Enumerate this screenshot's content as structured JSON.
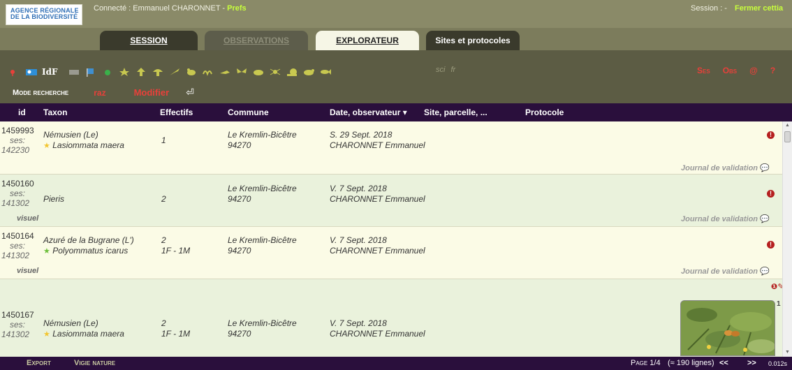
{
  "header": {
    "logo_line1": "AGENCE RÉGIONALE",
    "logo_line2": "DE LA BIODIVERSITÉ",
    "connected_label": "Connecté : Emmanuel CHARONNET - ",
    "prefs_label": "Prefs",
    "session_label": "Session : -",
    "close_label": "Fermer cettia"
  },
  "tabs": [
    {
      "label": "SESSION"
    },
    {
      "label": "OBSERVATIONS"
    },
    {
      "label": "EXPLORATEUR"
    },
    {
      "label": "Sites et protocoles"
    }
  ],
  "toolbar": {
    "idf_label": "IdF",
    "sci_label": "sci",
    "fr_label": "fr",
    "ses_label": "Ses",
    "obs_label": "Obs",
    "at_label": "@",
    "help_label": "?",
    "mode_label": "Mode recherche",
    "raz_label": "raz",
    "modifier_label": "Modifier",
    "taxon_group_icons": [
      "bird-icon",
      "tree-icon",
      "mushroom-icon",
      "dragonfly-icon",
      "frog-icon",
      "worm-icon",
      "grasshopper-icon",
      "butterfly-icon",
      "beetle-icon",
      "spider-icon",
      "snail-icon",
      "mammal-icon",
      "fish-icon"
    ]
  },
  "table": {
    "columns": [
      "id",
      "Taxon",
      "Effectifs",
      "Commune",
      "Date, observateur ▾",
      "Site, parcelle, ...",
      "Protocole"
    ],
    "rows": [
      {
        "id": "1459993",
        "ses_label": "ses:",
        "ses_id": "142230",
        "taxon_fr": "Némusien (Le)",
        "taxon_sci": "Lasiommata maera",
        "star_color": "#f2c530",
        "effectifs": "1",
        "effectifs_detail": "",
        "commune": "Le Kremlin-Bicêtre",
        "postcode": "94270",
        "date": "S. 29 Sept. 2018",
        "observer": "CHARONNET Emmanuel",
        "visuel": "",
        "journal": "Journal de validation",
        "bg": "#fbfbe6"
      },
      {
        "id": "1450160",
        "ses_label": "ses:",
        "ses_id": "141302",
        "taxon_fr": "Pieris",
        "taxon_sci": "",
        "star_color": "",
        "effectifs": "2",
        "effectifs_detail": "",
        "commune": "Le Kremlin-Bicêtre",
        "postcode": "94270",
        "date": "V. 7 Sept. 2018",
        "observer": "CHARONNET Emmanuel",
        "visuel": "visuel",
        "journal": "Journal de validation",
        "bg": "#eaf2dc"
      },
      {
        "id": "1450164",
        "ses_label": "ses:",
        "ses_id": "141302",
        "taxon_fr": "Azuré de la Bugrane (L')",
        "taxon_sci": "Polyommatus icarus",
        "star_color": "#6cbf3a",
        "effectifs": "2",
        "effectifs_detail": "1F - 1M",
        "commune": "Le Kremlin-Bicêtre",
        "postcode": "94270",
        "date": "V. 7 Sept. 2018",
        "observer": "CHARONNET Emmanuel",
        "visuel": "visuel",
        "journal": "Journal de validation",
        "bg": "#fbfbe6"
      },
      {
        "id": "1450167",
        "ses_label": "ses:",
        "ses_id": "141302",
        "taxon_fr": "Némusien (Le)",
        "taxon_sci": "Lasiommata maera",
        "star_color": "#f2c530",
        "effectifs": "2",
        "effectifs_detail": "1F - 1M",
        "commune": "Le Kremlin-Bicêtre",
        "postcode": "94270",
        "date": "V. 7 Sept. 2018",
        "observer": "CHARONNET Emmanuel",
        "visuel": "",
        "journal": "",
        "bg": "#eaf2dc",
        "photo_count": "1"
      }
    ]
  },
  "footer": {
    "export_label": "Export",
    "vigie_label": "Vigie nature",
    "page_label": "Page 1/4",
    "lines_label": "(≈ 190 lignes)",
    "prev_label": "<<",
    "next_label": ">>",
    "timing": "0.012s"
  },
  "colors": {
    "accent_red": "#e8403a",
    "header_purple": "#2a0f3c",
    "olive": "#5c5c44",
    "lime": "#c8ff3c"
  }
}
